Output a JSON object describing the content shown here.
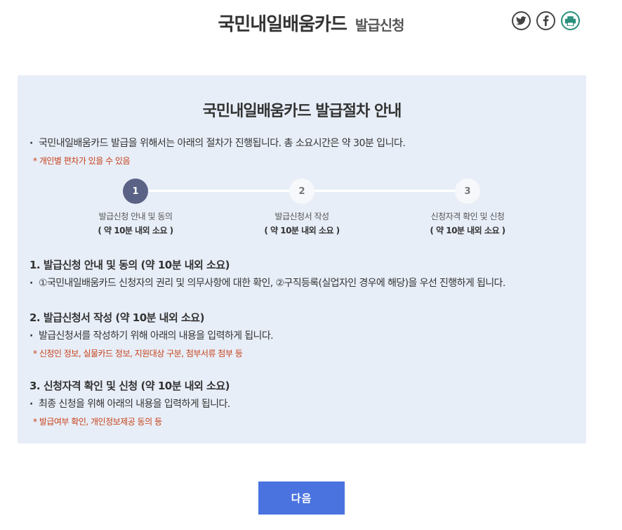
{
  "header": {
    "title": "국민내일배움카드",
    "subtitle": "발급신청",
    "share": [
      {
        "icon": "twitter-icon",
        "color": "#444444"
      },
      {
        "icon": "facebook-icon",
        "color": "#444444"
      },
      {
        "icon": "print-icon",
        "color": "#2a8f7c"
      }
    ]
  },
  "guide": {
    "title": "국민내일배움카드 발급절차 안내",
    "intro": "국민내일배움카드 발급을 위해서는 아래의 절차가 진행됩니다. 총 소요시간은 약 30분 입니다.",
    "intro_note": "* 개인별 편차가 있을 수 있음",
    "steps": [
      {
        "number": "1",
        "label": "발급신청 안내 및 동의",
        "duration": "( 약 10분 내외 소요 )",
        "active": true
      },
      {
        "number": "2",
        "label": "발급신청서 작성",
        "duration": "( 약 10분 내외 소요 )",
        "active": false
      },
      {
        "number": "3",
        "label": "신청자격 확인 및 신청",
        "duration": "( 약 10분 내외 소요 )",
        "active": false
      }
    ],
    "sections": [
      {
        "heading": "1. 발급신청 안내 및 동의 (약 10분 내외 소요)",
        "desc": "①국민내일배움카드 신청자의 권리 및 의무사항에 대한 확인, ②구직등록(실업자인 경우에 해당)을 우선 진행하게 됩니다.",
        "note": ""
      },
      {
        "heading": "2. 발급신청서 작성 (약 10분 내외 소요)",
        "desc": "발급신청서를 작성하기 위해 아래의 내용을 입력하게 됩니다.",
        "note": "* 신청인 정보, 실물카드 정보, 지원대상 구분, 첨부서류 첨부 등"
      },
      {
        "heading": "3. 신청자격 확인 및 신청 (약 10분 내외 소요)",
        "desc": "최종 신청을 위해 아래의 내용을 입력하게 됩니다.",
        "note": "* 발급여부 확인, 개인정보제공 동의 등"
      }
    ]
  },
  "actions": {
    "next_label": "다음"
  },
  "colors": {
    "panel_bg": "#e8eef8",
    "active_step": "#5a6286",
    "button": "#4a73e0",
    "note": "#c6421a"
  }
}
